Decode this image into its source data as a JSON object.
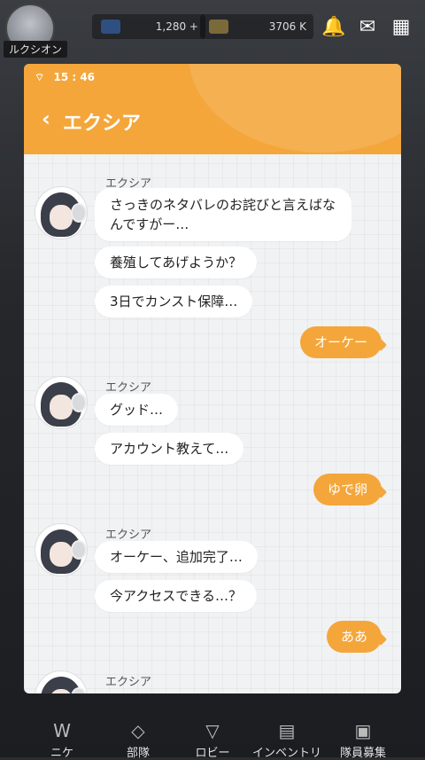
{
  "background": {
    "username": "ルクシオン",
    "currency1": "1,280 +",
    "currency2": "3706 K",
    "nav": [
      "ニケ",
      "部隊",
      "ロビー",
      "インベントリ",
      "隊員募集"
    ]
  },
  "status_bar": {
    "time": "15 : 46"
  },
  "header": {
    "title": "エクシア",
    "back_icon": "chevron-left-icon"
  },
  "colors": {
    "accent": "#f4a63b",
    "chat_bg": "#f1f2f4"
  },
  "messages": [
    {
      "sender": "エクシア",
      "bubbles": [
        "さっきのネタバレのお詫びと言えばなんですがー…",
        "養殖してあげようか？",
        "3日でカンスト保障…"
      ]
    },
    {
      "reply": "オーケー"
    },
    {
      "sender": "エクシア",
      "bubbles": [
        "グッド…",
        "アカウント教えて…"
      ]
    },
    {
      "reply": "ゆで卵"
    },
    {
      "sender": "エクシア",
      "bubbles": [
        "オーケー、追加完了…",
        "今アクセスできる…？"
      ]
    },
    {
      "reply": "ああ"
    },
    {
      "sender": "エクシア",
      "bubbles": []
    }
  ]
}
